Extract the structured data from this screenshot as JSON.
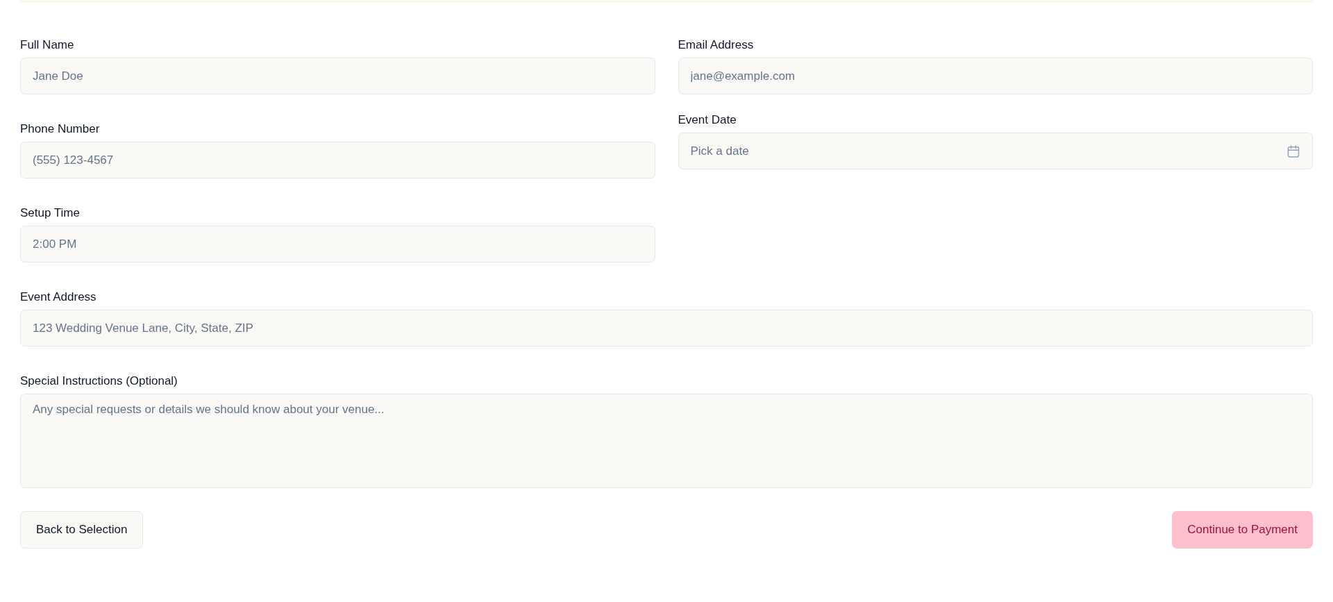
{
  "columns": [
    {
      "fields": [
        {
          "kind": "text",
          "label": "Full Name",
          "placeholder": "Jane Doe"
        },
        {
          "kind": "text",
          "label": "Phone Number",
          "placeholder": "(555) 123-4567"
        },
        {
          "kind": "text",
          "label": "Setup Time",
          "placeholder": "2:00 PM"
        }
      ]
    },
    {
      "fields": [
        {
          "kind": "text",
          "label": "Email Address",
          "placeholder": "jane@example.com"
        },
        {
          "kind": "date",
          "label": "Event Date",
          "placeholder": "Pick a date"
        }
      ]
    }
  ],
  "address": {
    "kind": "text",
    "label": "Event Address",
    "placeholder": "123 Wedding Venue Lane, City, State, ZIP"
  },
  "instructions": {
    "kind": "textarea",
    "label": "Special Instructions (Optional)",
    "placeholder": "Any special requests or details we should know about your venue..."
  },
  "buttons": {
    "back": "Back to Selection",
    "next": "Continue to Payment"
  }
}
